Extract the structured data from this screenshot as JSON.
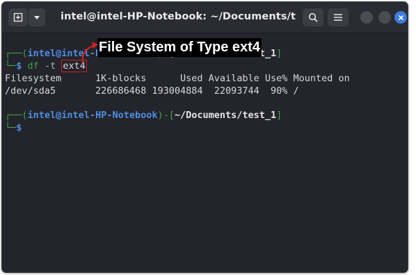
{
  "window": {
    "title": "intel@intel-HP-Notebook: ~/Documents/test...",
    "accent": "#3d7be0"
  },
  "terminal": {
    "prompt1": {
      "open": "┌──(",
      "user": "intel",
      "at": "@",
      "host": "intel-HP-Notebook",
      "close": ")-[",
      "cwd": "~/Documents/test_1",
      "end": "]"
    },
    "command": {
      "corner": "└─",
      "dollar": "$",
      "cmd": "df",
      "flag": "-t",
      "arg": "ext4"
    },
    "output": {
      "header": "Filesystem      1K-blocks      Used Available Use% Mounted on",
      "row": "/dev/sda5       226686468 193004884  22093744  90% /"
    },
    "prompt2": {
      "open": "┌──(",
      "user": "intel",
      "at": "@",
      "host": "intel-HP-Notebook",
      "close": ")-[",
      "cwd": "~/Documents/test_1",
      "end": "]"
    },
    "prompt2_line2": {
      "corner": "└─",
      "dollar": "$"
    }
  },
  "annotation": {
    "label": "File System of Type ext4",
    "color": "#d32020"
  },
  "icons": [
    "new-tab-icon",
    "chevron-down-icon",
    "search-icon",
    "hamburger-menu-icon",
    "minimize-icon",
    "maximize-icon",
    "close-icon"
  ]
}
